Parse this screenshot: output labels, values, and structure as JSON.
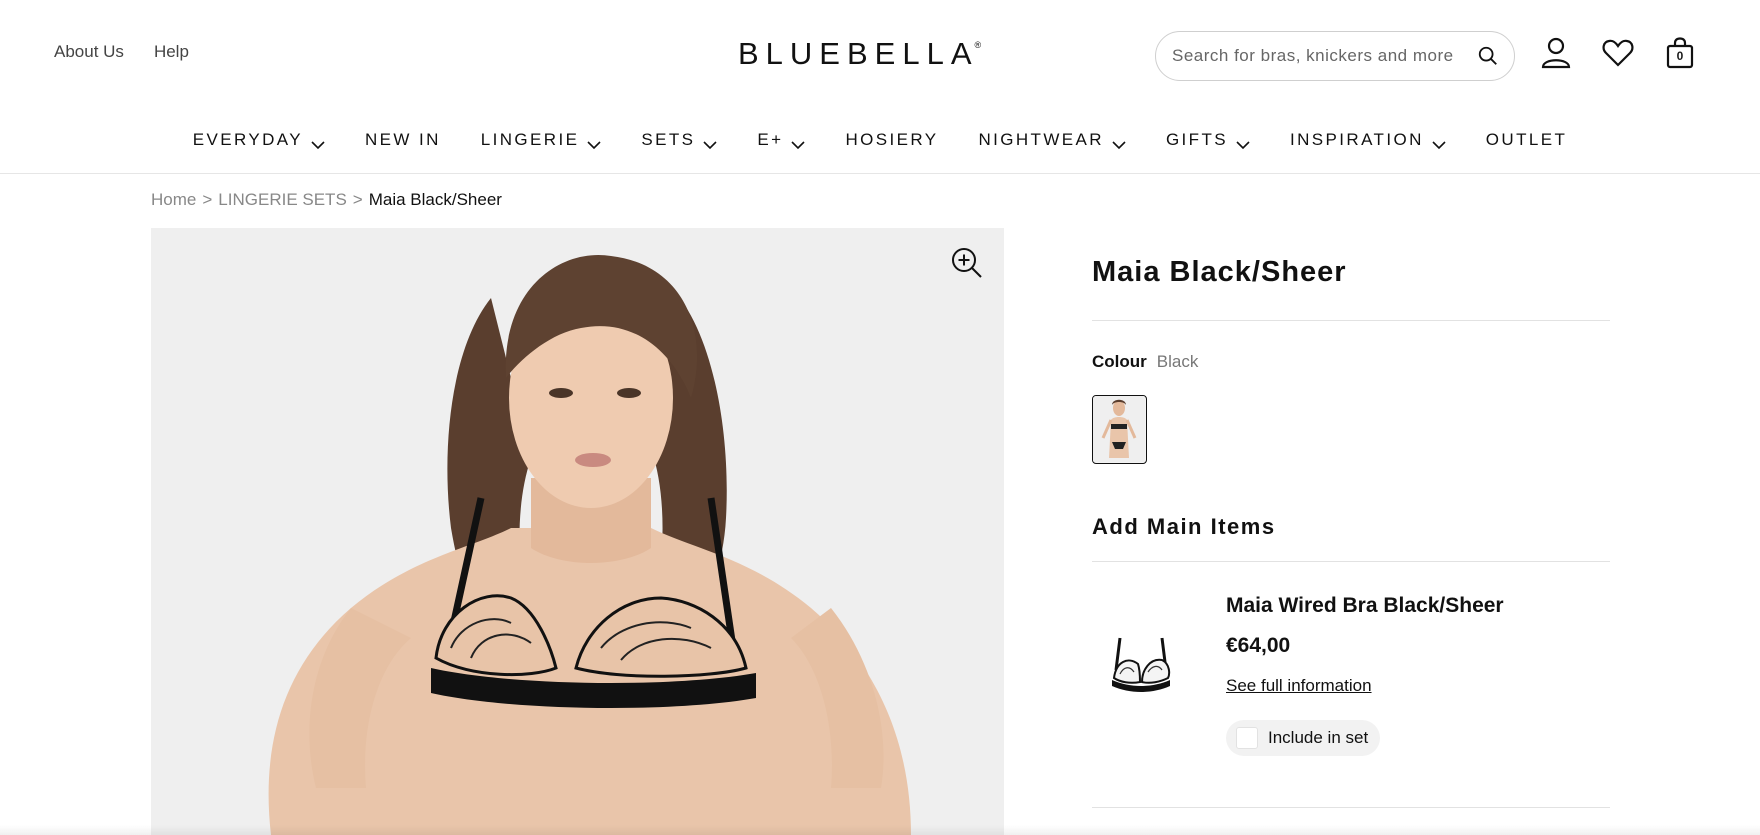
{
  "top_links": {
    "about": "About Us",
    "help": "Help"
  },
  "brand": {
    "logo_text": "BLUEBELLA",
    "registered_mark": "®"
  },
  "search": {
    "placeholder": "Search for bras, knickers and more",
    "value": ""
  },
  "header_icons": {
    "account": "user-icon",
    "wishlist": "heart-icon",
    "bag": "bag-icon",
    "bag_count": "0"
  },
  "nav": {
    "items": [
      {
        "label": "EVERYDAY",
        "has_dropdown": true
      },
      {
        "label": "NEW IN",
        "has_dropdown": false
      },
      {
        "label": "LINGERIE",
        "has_dropdown": true
      },
      {
        "label": "SETS",
        "has_dropdown": true
      },
      {
        "label": "E+",
        "has_dropdown": true
      },
      {
        "label": "HOSIERY",
        "has_dropdown": false
      },
      {
        "label": "NIGHTWEAR",
        "has_dropdown": true
      },
      {
        "label": "GIFTS",
        "has_dropdown": true
      },
      {
        "label": "INSPIRATION",
        "has_dropdown": true
      },
      {
        "label": "OUTLET",
        "has_dropdown": false
      }
    ]
  },
  "breadcrumb": {
    "home": "Home",
    "category": "LINGERIE SETS",
    "current": "Maia Black/Sheer",
    "separator": ">"
  },
  "product": {
    "title": "Maia Black/Sheer",
    "colour_label": "Colour",
    "colour_value": "Black"
  },
  "main_items": {
    "title": "Add Main Items",
    "items": [
      {
        "name": "Maia Wired Bra Black/Sheer",
        "price": "€64,00",
        "link": "See full information",
        "include_label": "Include in set",
        "included": false
      }
    ]
  },
  "colors": {
    "text": "#111111",
    "muted": "#888888",
    "image_bg": "#efefef",
    "border": "#e2e2e2"
  }
}
